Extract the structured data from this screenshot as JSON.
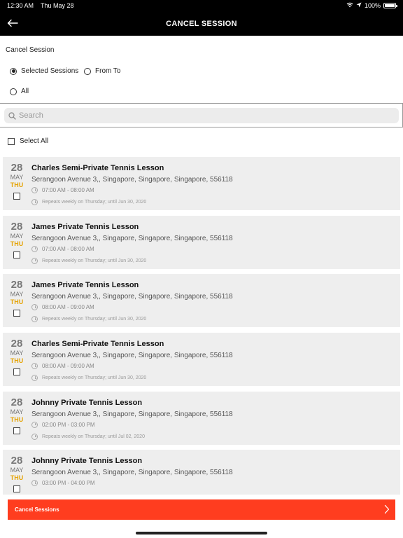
{
  "status_bar": {
    "time": "12:30 AM",
    "date": "Thu May 28",
    "battery": "100%"
  },
  "navbar": {
    "title": "CANCEL SESSION"
  },
  "section_label": "Cancel Session",
  "options": {
    "selected_sessions": "Selected Sessions",
    "from_to": "From To",
    "all": "All",
    "selected": "selected_sessions"
  },
  "search": {
    "placeholder": "Search",
    "value": ""
  },
  "select_all_label": "Select All",
  "sessions": [
    {
      "day": "28",
      "month": "MAY",
      "weekday": "THU",
      "name": "Charles Semi-Private Tennis Lesson",
      "address": "Serangoon Avenue 3,, Singapore, Singapore, Singapore, 556118",
      "time": "07:00 AM - 08:00 AM",
      "repeat": "Repeats weekly on Thursday; until Jun 30, 2020"
    },
    {
      "day": "28",
      "month": "MAY",
      "weekday": "THU",
      "name": "James Private Tennis Lesson",
      "address": "Serangoon Avenue 3,, Singapore, Singapore, Singapore, 556118",
      "time": "07:00 AM - 08:00 AM",
      "repeat": "Repeats weekly on Thursday; until Jun 30, 2020"
    },
    {
      "day": "28",
      "month": "MAY",
      "weekday": "THU",
      "name": "James Private Tennis Lesson",
      "address": "Serangoon Avenue 3,, Singapore, Singapore, Singapore, 556118",
      "time": "08:00 AM - 09:00 AM",
      "repeat": "Repeats weekly on Thursday; until Jun 30, 2020"
    },
    {
      "day": "28",
      "month": "MAY",
      "weekday": "THU",
      "name": "Charles Semi-Private Tennis Lesson",
      "address": "Serangoon Avenue 3,, Singapore, Singapore, Singapore, 556118",
      "time": "08:00 AM - 09:00 AM",
      "repeat": "Repeats weekly on Thursday; until Jun 30, 2020"
    },
    {
      "day": "28",
      "month": "MAY",
      "weekday": "THU",
      "name": "Johnny Private Tennis Lesson",
      "address": "Serangoon Avenue 3,, Singapore, Singapore, Singapore, 556118",
      "time": "02:00 PM - 03:00 PM",
      "repeat": "Repeats weekly on Thursday; until Jul 02, 2020"
    },
    {
      "day": "28",
      "month": "MAY",
      "weekday": "THU",
      "name": "Johnny Private Tennis Lesson",
      "address": "Serangoon Avenue 3,, Singapore, Singapore, Singapore, 556118",
      "time": "03:00 PM - 04:00 PM",
      "repeat": ""
    }
  ],
  "cancel_button_label": "Cancel Sessions",
  "colors": {
    "accent": "#ff3d1f",
    "weekday": "#e5a50a",
    "card_bg": "#eeeeee"
  }
}
